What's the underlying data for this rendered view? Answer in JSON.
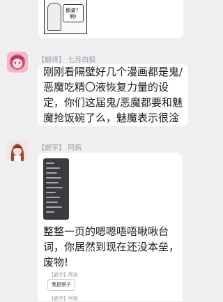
{
  "messages": [
    {
      "sender_tag": "【翻译】",
      "sender_name": "七月白狐",
      "text": "刚刚看隔壁好几个漫画都是鬼/恶魔吃精〇液恢复力量的设定，你们这届鬼/恶魔都要和魅魔抢饭碗了么，魅魔表示很淦"
    },
    {
      "sender_tag": "【嵌字】",
      "sender_name": "阿疯",
      "text": "整整一页的嗯嗯唔唔啾啾台词，你居然到现在还没本垒，废物!"
    }
  ],
  "top_image": {
    "bubble_text": "鹅姿？ 啊!"
  },
  "nested_quote": {
    "sender": "【嵌字】阿疯",
    "card_text": "我是腕子",
    "sender_2": "【嵌字】阿疯"
  },
  "colors": {
    "background": "#efeff1",
    "bubble": "#ffffff",
    "name": "#9aa0a6"
  }
}
